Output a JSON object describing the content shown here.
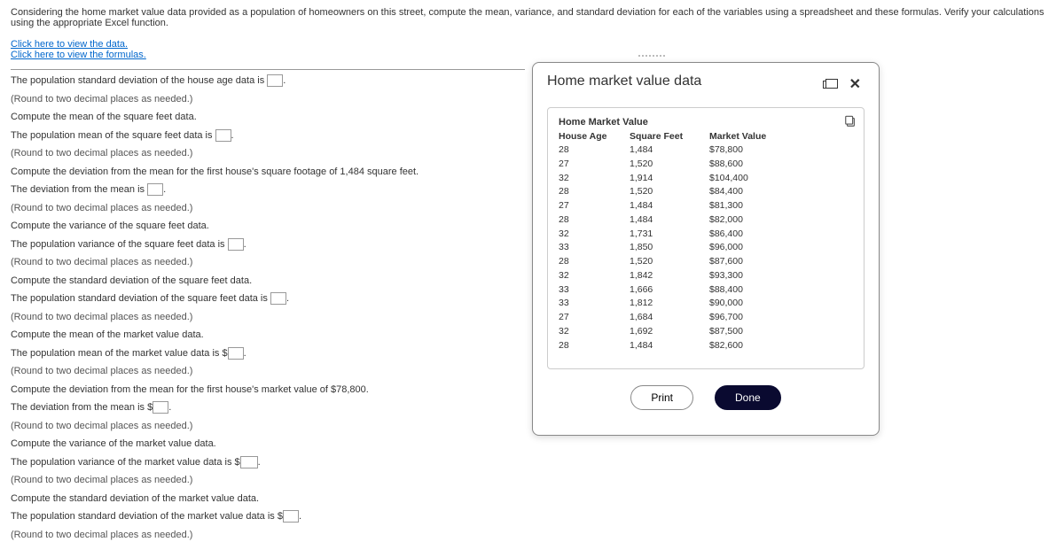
{
  "question": {
    "intro": "Considering the home market value data provided as a population of homeowners on this street, compute the mean, variance, and standard deviation for each of the variables using a spreadsheet and these formulas. Verify your calculations using the appropriate Excel function.",
    "link_data": "Click here to view the data.",
    "link_formulas": "Click here to view the formulas."
  },
  "prompts": {
    "sd_age_pre": "The population standard deviation of the house age data is ",
    "round": "(Round to two decimal places as needed.)",
    "compute_mean_sqft": "Compute the mean of the square feet data.",
    "mean_sqft_pre": "The population mean of the square feet data is ",
    "compute_dev_sqft": "Compute the deviation from the mean for the first house's square footage of 1,484 square feet.",
    "dev_pre": "The deviation from the mean is ",
    "compute_var_sqft": "Compute the variance of the square feet data.",
    "var_sqft_pre": "The population variance of the square feet data is ",
    "compute_sd_sqft": "Compute the standard deviation of the square feet data.",
    "sd_sqft_pre": "The population standard deviation of the square feet data is ",
    "compute_mean_mv": "Compute the mean of the market value data.",
    "mean_mv_pre": "The population mean of the market value data is $",
    "compute_dev_mv": "Compute the deviation from the mean for the first house's market value of $78,800.",
    "dev_mv_pre": "The deviation from the mean is $",
    "compute_var_mv": "Compute the variance of the market value data.",
    "var_mv_pre": "The population variance of the market value data is $",
    "compute_sd_mv": "Compute the standard deviation of the market value data.",
    "sd_mv_pre": "The population standard deviation of the market value data is $",
    "period": "."
  },
  "modal": {
    "title": "Home market value data",
    "data_title": "Home Market Value",
    "header": {
      "c1": "House Age",
      "c2": "Square Feet",
      "c3": "Market Value"
    },
    "rows": [
      {
        "c1": "28",
        "c2": "1,484",
        "c3": "$78,800"
      },
      {
        "c1": "27",
        "c2": "1,520",
        "c3": "$88,600"
      },
      {
        "c1": "32",
        "c2": "1,914",
        "c3": "$104,400"
      },
      {
        "c1": "28",
        "c2": "1,520",
        "c3": "$84,400"
      },
      {
        "c1": "27",
        "c2": "1,484",
        "c3": "$81,300"
      },
      {
        "c1": "28",
        "c2": "1,484",
        "c3": "$82,000"
      },
      {
        "c1": "32",
        "c2": "1,731",
        "c3": "$86,400"
      },
      {
        "c1": "33",
        "c2": "1,850",
        "c3": "$96,000"
      },
      {
        "c1": "28",
        "c2": "1,520",
        "c3": "$87,600"
      },
      {
        "c1": "32",
        "c2": "1,842",
        "c3": "$93,300"
      },
      {
        "c1": "33",
        "c2": "1,666",
        "c3": "$88,400"
      },
      {
        "c1": "33",
        "c2": "1,812",
        "c3": "$90,000"
      },
      {
        "c1": "27",
        "c2": "1,684",
        "c3": "$96,700"
      },
      {
        "c1": "32",
        "c2": "1,692",
        "c3": "$87,500"
      },
      {
        "c1": "28",
        "c2": "1,484",
        "c3": "$82,600"
      }
    ],
    "print": "Print",
    "done": "Done"
  }
}
